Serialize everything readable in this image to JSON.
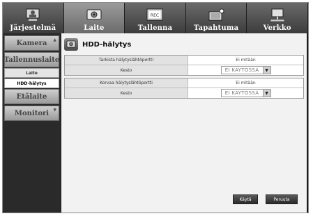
{
  "top_tabs": [
    {
      "label": "Järjestelmä",
      "icon": "system-icon",
      "active": false
    },
    {
      "label": "Laite",
      "icon": "device-icon",
      "active": true
    },
    {
      "label": "Tallenna",
      "icon": "record-icon",
      "active": false
    },
    {
      "label": "Tapahtuma",
      "icon": "event-icon",
      "active": false
    },
    {
      "label": "Verkko",
      "icon": "network-icon",
      "active": false
    }
  ],
  "record_badge": "REC",
  "sidebar": {
    "kamera": "Kamera",
    "tallennuslaite": "Tallennuslaite",
    "laite": "Laite",
    "hdd_halytys": "HDD-hälytys",
    "etalaite": "Etälaite",
    "monitori": "Monitori"
  },
  "page": {
    "title": "HDD-hälytys"
  },
  "group1": {
    "row1_label": "Tarkista hälytyslähtöportti",
    "row1_value": "Ei mitään",
    "row2_label": "Kesto",
    "row2_value": "EI KÄYTÖSSÄ"
  },
  "group2": {
    "row1_label": "Korvaa hälytyslähtöportti",
    "row1_value": "Ei mitään",
    "row2_label": "Kesto",
    "row2_value": "EI KÄYTÖSSÄ"
  },
  "buttons": {
    "apply": "Käytä",
    "cancel": "Peruuta"
  },
  "colors": {
    "active_tab": "#8a8a8a",
    "background": "#1b1b1b",
    "content_bg": "#f2f2f2"
  }
}
